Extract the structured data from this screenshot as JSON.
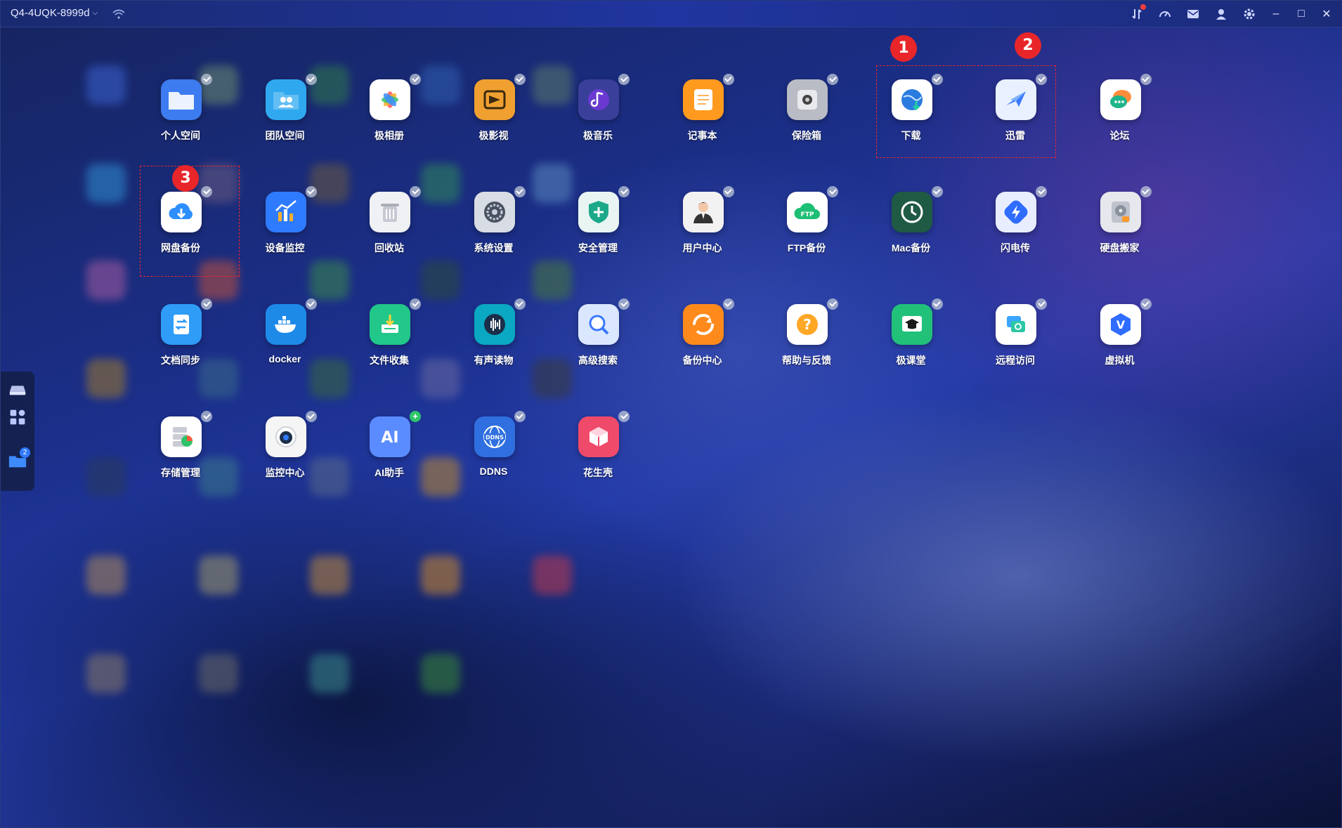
{
  "titlebar": {
    "device_name": "Q4-4UQK-8999d",
    "icons": [
      "transfer-icon",
      "speed-icon",
      "mail-icon",
      "user-icon",
      "settings-icon"
    ],
    "window_controls": [
      "minimize-icon",
      "maximize-icon",
      "close-icon"
    ]
  },
  "dock": {
    "items": [
      "drive-icon",
      "apps-icon",
      "folder-icon"
    ],
    "folder_badge": "2"
  },
  "apps": [
    {
      "label": "个人空间",
      "icon": "folder-icon",
      "color": "#3d7bf0"
    },
    {
      "label": "团队空间",
      "icon": "team-folder-icon",
      "color": "#2fa8f0"
    },
    {
      "label": "极相册",
      "icon": "photos-icon",
      "color": "#ffffff"
    },
    {
      "label": "极影视",
      "icon": "video-icon",
      "color": "#f0a030"
    },
    {
      "label": "极音乐",
      "icon": "music-icon",
      "color": "#3a3f9a"
    },
    {
      "label": "记事本",
      "icon": "notepad-icon",
      "color": "#ff9a1f"
    },
    {
      "label": "保险箱",
      "icon": "safe-icon",
      "color": "#b9bcc4"
    },
    {
      "label": "下载",
      "icon": "download-globe-icon",
      "color": "#ffffff"
    },
    {
      "label": "迅雷",
      "icon": "thunder-bird-icon",
      "color": "#e9f0ff"
    },
    {
      "label": "论坛",
      "icon": "forum-icon",
      "color": "#ffffff"
    },
    {
      "label": "网盘备份",
      "icon": "cloud-download-icon",
      "color": "#ffffff"
    },
    {
      "label": "设备监控",
      "icon": "monitor-chart-icon",
      "color": "#2f7bff"
    },
    {
      "label": "回收站",
      "icon": "trash-icon",
      "color": "#f0f1f4"
    },
    {
      "label": "系统设置",
      "icon": "system-settings-icon",
      "color": "#d8dce4"
    },
    {
      "label": "安全管理",
      "icon": "shield-icon",
      "color": "#e9f5f2"
    },
    {
      "label": "用户中心",
      "icon": "user-center-icon",
      "color": "#f2f2f2"
    },
    {
      "label": "FTP备份",
      "icon": "ftp-cloud-icon",
      "color": "#ffffff"
    },
    {
      "label": "Mac备份",
      "icon": "clock-icon",
      "color": "#1f5a45"
    },
    {
      "label": "闪电传",
      "icon": "lightning-transfer-icon",
      "color": "#e8eeff"
    },
    {
      "label": "硬盘搬家",
      "icon": "hard-disk-icon",
      "color": "#e6e8ee"
    },
    {
      "label": "文档同步",
      "icon": "doc-sync-icon",
      "color": "#2f9cf7"
    },
    {
      "label": "docker",
      "icon": "docker-icon",
      "color": "#1e8ae8"
    },
    {
      "label": "文件收集",
      "icon": "file-collect-icon",
      "color": "#22c78a"
    },
    {
      "label": "有声读物",
      "icon": "audiobook-icon",
      "color": "#0aa8c2"
    },
    {
      "label": "高级搜索",
      "icon": "advanced-search-icon",
      "color": "#dbe7ff"
    },
    {
      "label": "备份中心",
      "icon": "backup-center-icon",
      "color": "#ff8a1c"
    },
    {
      "label": "帮助与反馈",
      "icon": "help-icon",
      "color": "#ffffff"
    },
    {
      "label": "极课堂",
      "icon": "classroom-icon",
      "color": "#21c17a"
    },
    {
      "label": "远程访问",
      "icon": "remote-access-icon",
      "color": "#ffffff"
    },
    {
      "label": "虚拟机",
      "icon": "virtual-machine-icon",
      "color": "#ffffff"
    },
    {
      "label": "存储管理",
      "icon": "storage-icon",
      "color": "#ffffff"
    },
    {
      "label": "监控中心",
      "icon": "camera-icon",
      "color": "#f5f5f5"
    },
    {
      "label": "AI助手",
      "icon": "ai-assistant-icon",
      "color": "#5b8cff"
    },
    {
      "label": "DDNS",
      "icon": "ddns-icon",
      "color": "#2f6fe0"
    },
    {
      "label": "花生壳",
      "icon": "peanut-shell-icon",
      "color": "#f04a6b"
    }
  ],
  "annotations": {
    "markers": [
      "1",
      "2",
      "3"
    ]
  }
}
